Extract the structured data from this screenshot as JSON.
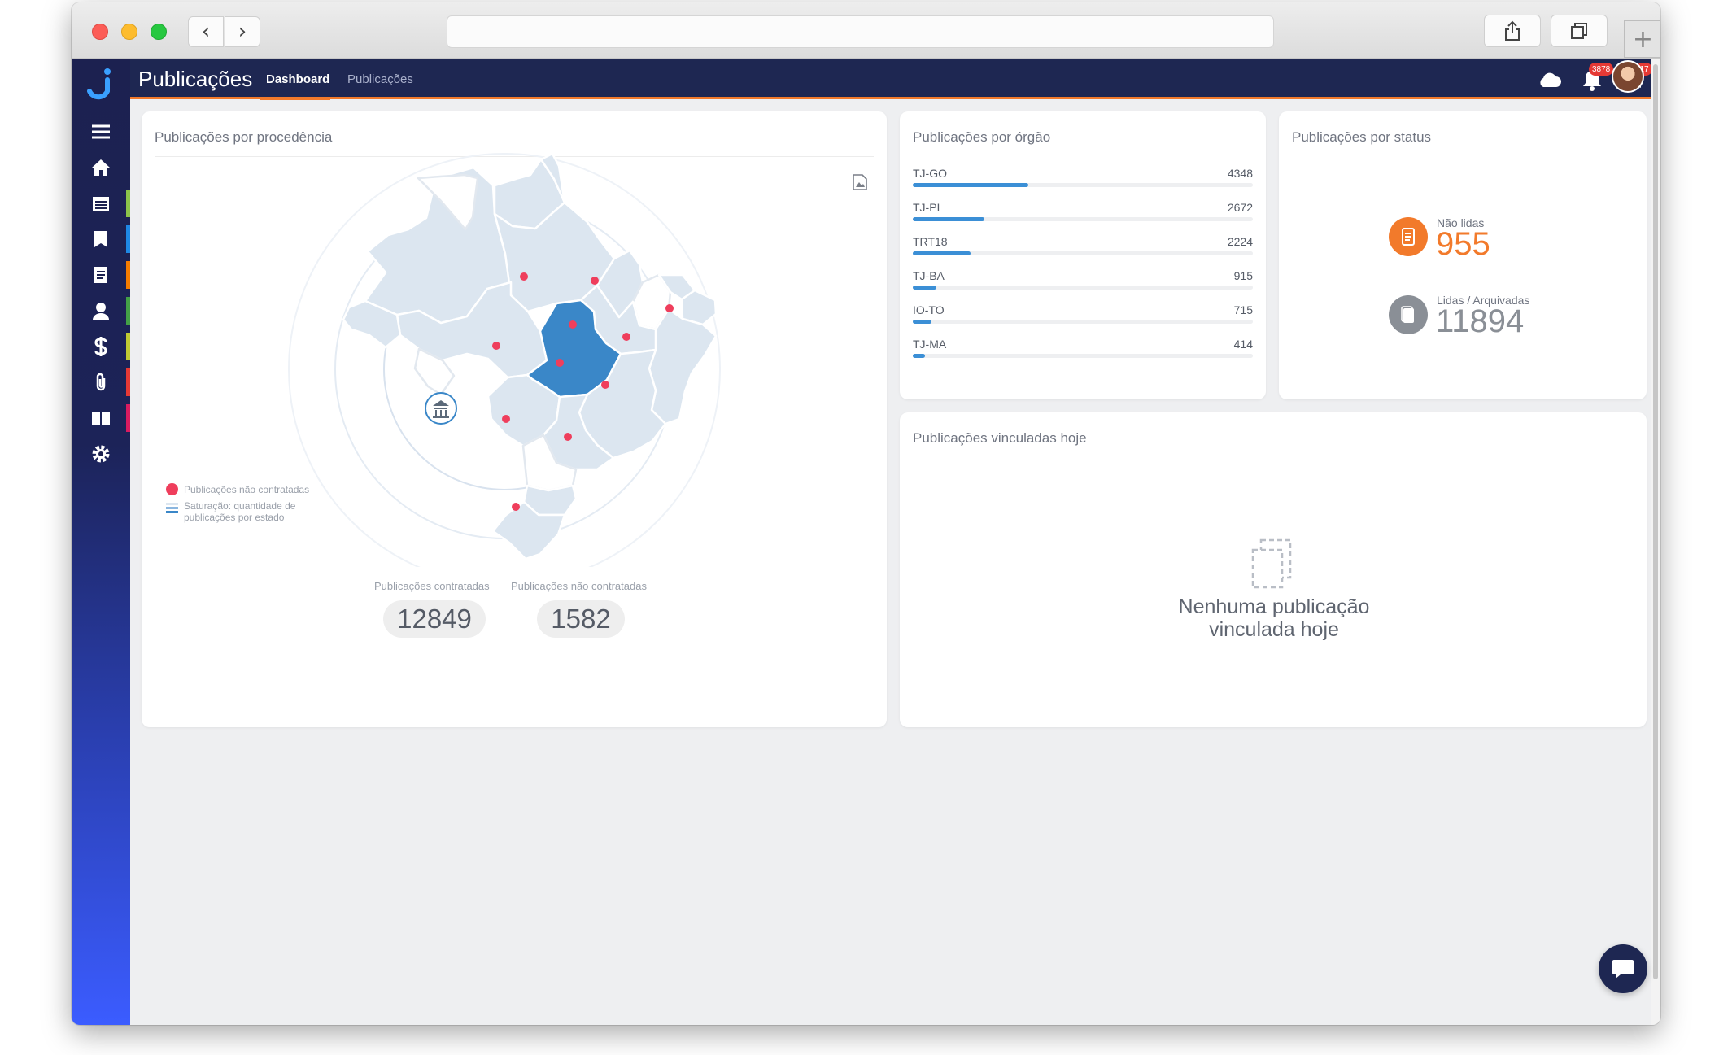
{
  "browser": {
    "back_glyph": "‹",
    "forward_glyph": "›",
    "new_tab_glyph": "+"
  },
  "app": {
    "title": "Publicações",
    "tabs": [
      {
        "label": "Dashboard",
        "active": true
      },
      {
        "label": "Publicações",
        "active": false
      }
    ],
    "notifications_badge": "3878",
    "alerts_badge": "17"
  },
  "sidebar": {
    "items": [
      {
        "icon": "menu-icon",
        "stripe": null
      },
      {
        "icon": "home-icon",
        "stripe": null
      },
      {
        "icon": "calendar-icon",
        "stripe": "#8bc34a"
      },
      {
        "icon": "tag-icon",
        "stripe": "#1e88e5"
      },
      {
        "icon": "document-icon",
        "stripe": "#f57c00"
      },
      {
        "icon": "user-icon",
        "stripe": "#43a047"
      },
      {
        "icon": "dollar-icon",
        "stripe": "#c0ca33"
      },
      {
        "icon": "paperclip-icon",
        "stripe": "#e53935"
      },
      {
        "icon": "book-icon",
        "stripe": "#d81b60"
      },
      {
        "icon": "gear-icon",
        "stripe": null
      }
    ]
  },
  "procedencia": {
    "title": "Publicações por procedência",
    "legend": {
      "not_contracted": "Publicações não contratadas",
      "saturation_line1": "Saturação: quantidade de",
      "saturation_line2": "publicações por estado"
    },
    "contracted_label": "Publicações contratadas",
    "contracted_value": "12849",
    "not_contracted_label": "Publicações não contratadas",
    "not_contracted_value": "1582"
  },
  "orgao": {
    "title": "Publicações por órgão",
    "rows": [
      {
        "name": "TJ-GO",
        "count": "4348",
        "fraction": 0.34
      },
      {
        "name": "TJ-PI",
        "count": "2672",
        "fraction": 0.21
      },
      {
        "name": "TRT18",
        "count": "2224",
        "fraction": 0.17
      },
      {
        "name": "TJ-BA",
        "count": "915",
        "fraction": 0.07
      },
      {
        "name": "IO-TO",
        "count": "715",
        "fraction": 0.055
      },
      {
        "name": "TJ-MA",
        "count": "414",
        "fraction": 0.035
      }
    ]
  },
  "status": {
    "title": "Publicações por status",
    "unread_label": "Não lidas",
    "unread_value": "955",
    "read_label": "Lidas / Arquivadas",
    "read_value": "11894",
    "unread_color": "#f27a2b",
    "read_color": "#8a8f96"
  },
  "vinculadas": {
    "title": "Publicações vinculadas hoje",
    "empty_line1": "Nenhuma publicação",
    "empty_line2": "vinculada hoje"
  },
  "colors": {
    "accent": "#f27a2b",
    "navy": "#1e2752",
    "bar": "#3b8fd6",
    "highlight_state": "#3a87c8",
    "dot": "#ef3e5c"
  }
}
